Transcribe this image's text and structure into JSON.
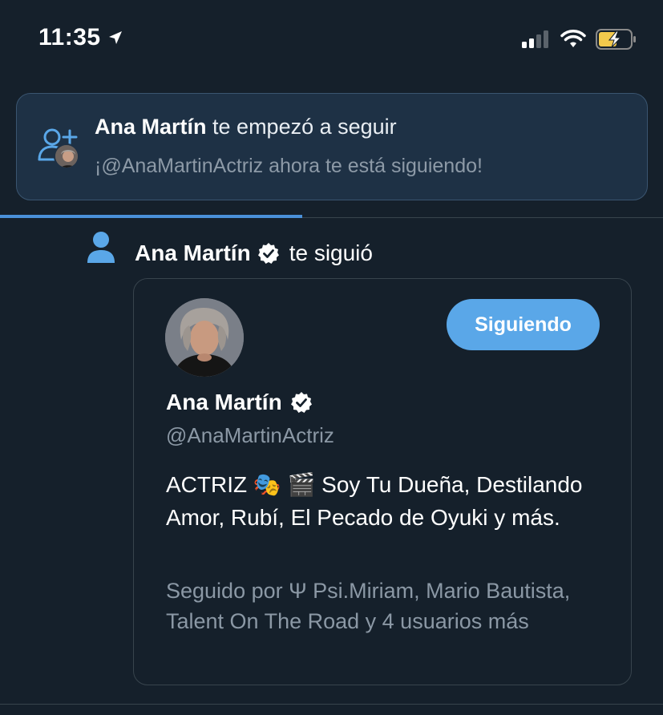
{
  "status_bar": {
    "time": "11:35"
  },
  "banner": {
    "name": "Ana Martín",
    "title_rest": "te empezó a seguir",
    "subtitle": "¡@AnaMartinActriz ahora te está siguiendo!"
  },
  "notification": {
    "name": "Ana Martín",
    "action": "te siguió"
  },
  "card": {
    "button_label": "Siguiendo",
    "name": "Ana Martín",
    "handle": "@AnaMartinActriz",
    "bio": "ACTRIZ 🎭 🎬 Soy Tu Dueña, Destilando Amor, Rubí, El Pecado de Oyuki y más.",
    "followed_by": "Seguido por Ψ Psi.Miriam, Mario Bautista, Talent On The Road y 4 usuarios más"
  },
  "colors": {
    "background": "#15202b",
    "accent": "#5aa7e8",
    "muted_text": "#8b98a5",
    "banner_bg": "#1e3145"
  },
  "icons": {
    "location": "location-arrow-icon",
    "signal": "cellular-signal-icon",
    "wifi": "wifi-icon",
    "battery": "battery-charging-icon",
    "follow": "person-add-icon",
    "person": "person-icon",
    "verified": "verified-badge-icon"
  }
}
